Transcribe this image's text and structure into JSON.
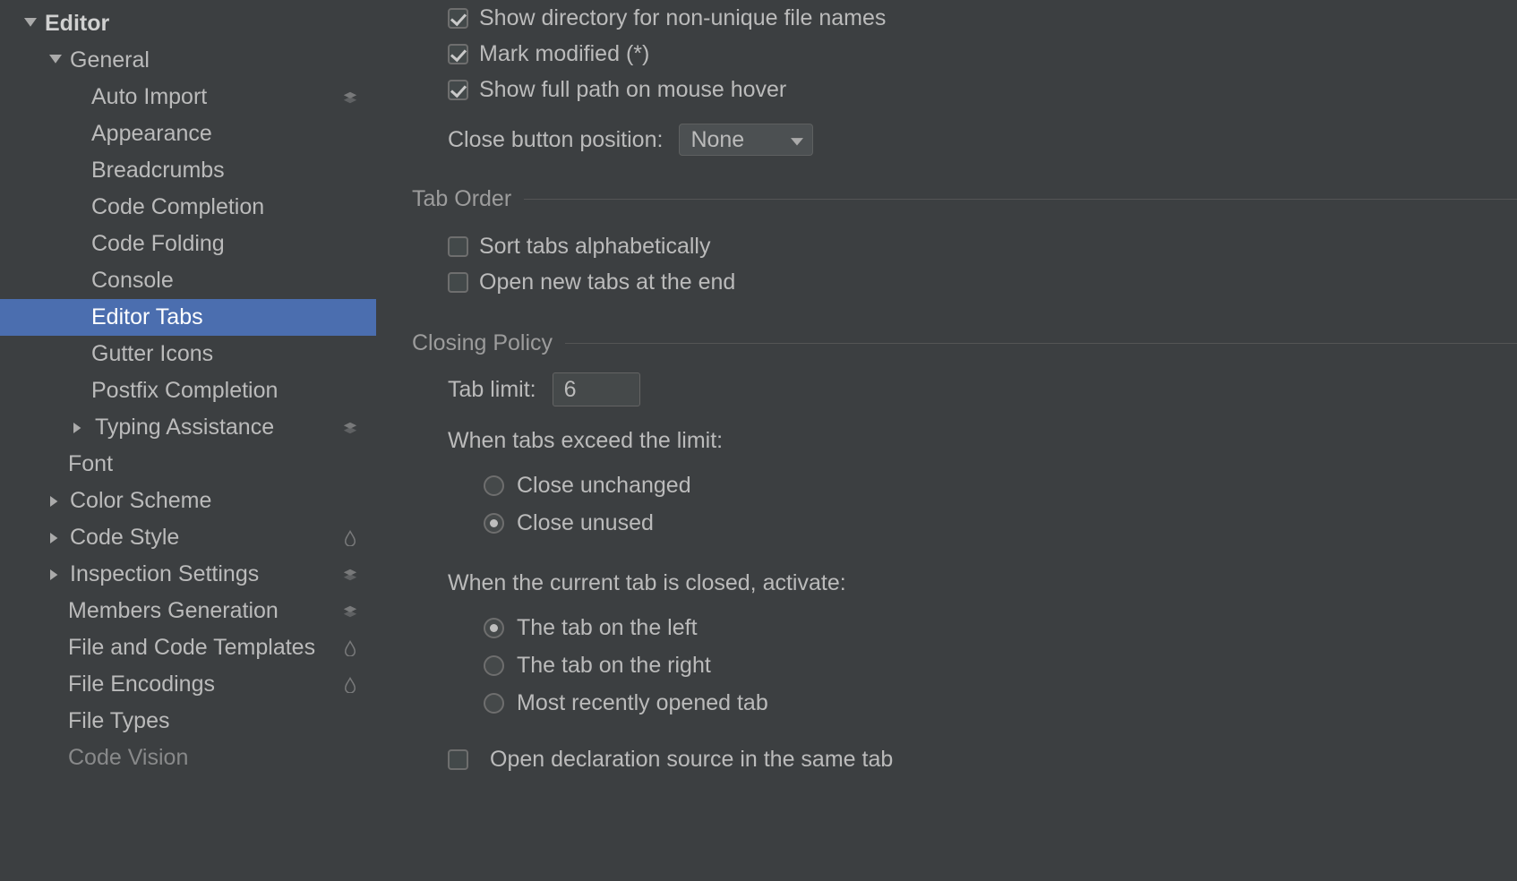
{
  "sidebar": {
    "editor": "Editor",
    "general": "General",
    "auto_import": "Auto Import",
    "appearance": "Appearance",
    "breadcrumbs": "Breadcrumbs",
    "code_completion": "Code Completion",
    "code_folding": "Code Folding",
    "console": "Console",
    "editor_tabs": "Editor Tabs",
    "gutter_icons": "Gutter Icons",
    "postfix_completion": "Postfix Completion",
    "typing_assistance": "Typing Assistance",
    "font": "Font",
    "color_scheme": "Color Scheme",
    "code_style": "Code Style",
    "inspection_settings": "Inspection Settings",
    "members_generation": "Members Generation",
    "file_and_code_templates": "File and Code Templates",
    "file_encodings": "File Encodings",
    "file_types": "File Types",
    "code_vision": "Code Vision"
  },
  "main": {
    "show_directory": "Show directory for non-unique file names",
    "mark_modified": "Mark modified (*)",
    "show_full_path": "Show full path on mouse hover",
    "close_button_position_label": "Close button position:",
    "close_button_position_value": "None",
    "section_tab_order": "Tab Order",
    "sort_tabs": "Sort tabs alphabetically",
    "open_new_tabs_end": "Open new tabs at the end",
    "section_closing_policy": "Closing Policy",
    "tab_limit_label": "Tab limit:",
    "tab_limit_value": "6",
    "when_exceed_label": "When tabs exceed the limit:",
    "close_unchanged": "Close unchanged",
    "close_unused": "Close unused",
    "when_current_closed_label": "When the current tab is closed, activate:",
    "tab_on_left": "The tab on the left",
    "tab_on_right": "The tab on the right",
    "most_recent": "Most recently opened tab",
    "open_declaration_same_tab": "Open declaration source in the same tab"
  }
}
